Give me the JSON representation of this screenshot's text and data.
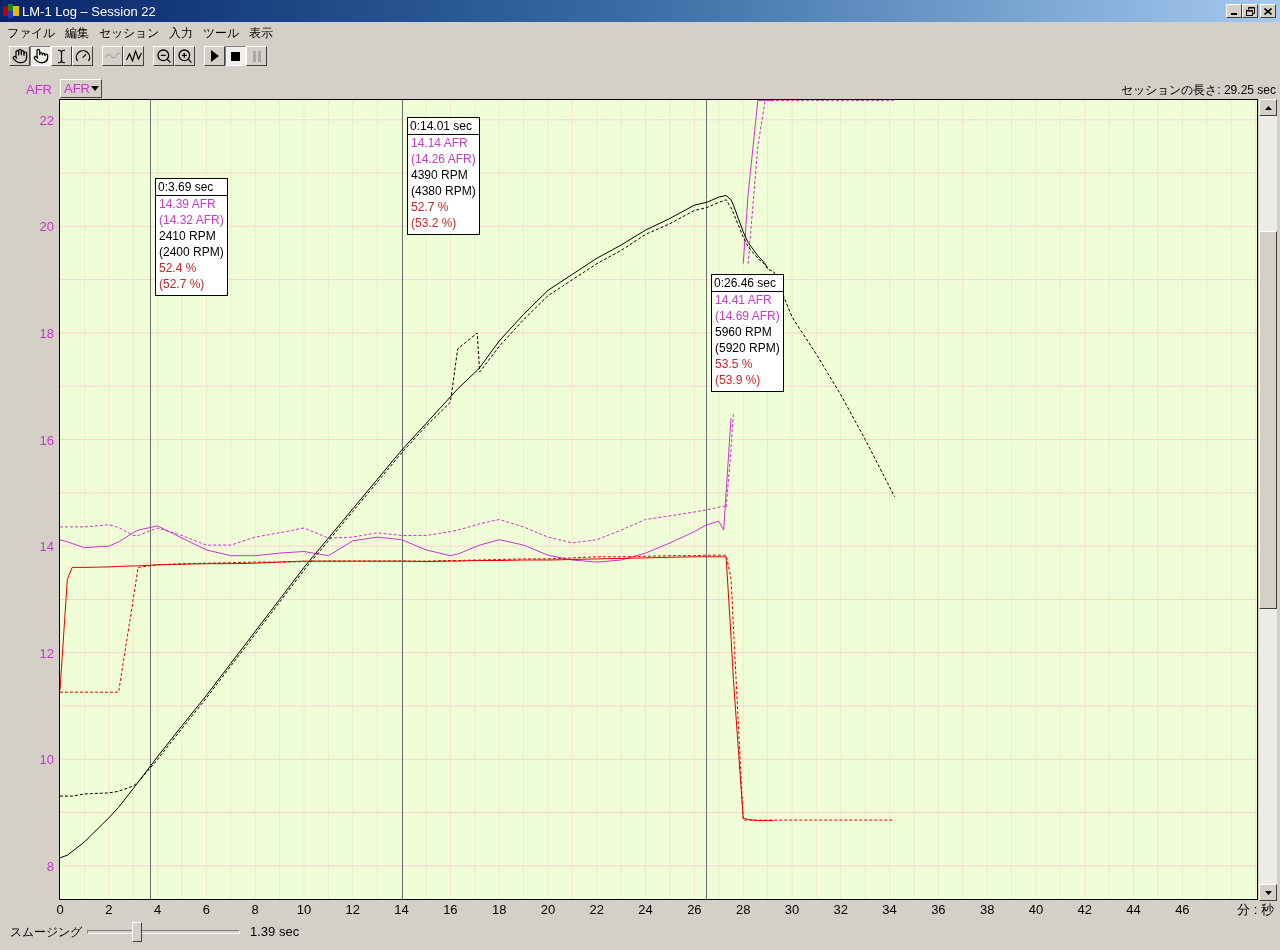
{
  "window": {
    "title": "LM-1 Log – Session 22"
  },
  "menu": [
    "ファイル",
    "編集",
    "セッション",
    "入力",
    "ツール",
    "表示"
  ],
  "toolbar": [
    {
      "buttons": [
        {
          "kind": "hand",
          "selected": false,
          "disabled": false
        },
        {
          "kind": "pointer",
          "selected": true,
          "disabled": false
        },
        {
          "kind": "cursor",
          "selected": false,
          "disabled": false
        },
        {
          "kind": "gauge",
          "selected": false,
          "disabled": false
        }
      ]
    },
    {
      "buttons": [
        {
          "kind": "smooth",
          "selected": false,
          "disabled": true
        },
        {
          "kind": "raw",
          "selected": false,
          "disabled": false
        }
      ]
    },
    {
      "buttons": [
        {
          "kind": "zoom_out",
          "selected": false,
          "disabled": false
        },
        {
          "kind": "zoom_in",
          "selected": false,
          "disabled": false
        }
      ]
    },
    {
      "buttons": [
        {
          "kind": "play",
          "selected": false,
          "disabled": false
        },
        {
          "kind": "stop",
          "selected": true,
          "disabled": false
        },
        {
          "kind": "pause",
          "selected": false,
          "disabled": true
        }
      ]
    }
  ],
  "chart": {
    "axis_selector": {
      "value": "AFR"
    },
    "session_length": "セッションの長さ: 29.25 sec",
    "chart_data": {
      "type": "line",
      "xlabel": "分 : 秒",
      "ylabel": "AFR",
      "grid": true,
      "xlim": [
        0,
        49.1
      ],
      "ylim": [
        7.36,
        22.39
      ],
      "xticks": [
        0,
        2,
        4,
        6,
        8,
        10,
        12,
        14,
        16,
        18,
        20,
        22,
        24,
        26,
        28,
        30,
        32,
        34,
        36,
        38,
        40,
        42,
        44,
        46
      ],
      "yticks": [
        8,
        10,
        12,
        14,
        16,
        18,
        20,
        22
      ],
      "x": [
        0,
        0.3,
        0.5,
        1,
        2,
        2.4,
        3,
        3.2,
        4,
        5,
        6,
        7,
        8,
        9,
        10,
        11,
        12,
        13,
        14,
        15,
        16,
        16.3,
        17.1,
        17.2,
        18,
        19,
        20,
        21,
        22,
        23,
        24,
        25,
        26,
        26.5,
        27,
        27.2,
        27.3,
        27.5,
        27.6,
        28,
        28.2,
        28.6,
        28.9,
        29,
        29.25,
        30,
        31,
        32,
        33,
        34.2
      ],
      "series": [
        {
          "color": "#cc33cc",
          "line_style": "solid",
          "values": [
            14.12,
            14.08,
            14.05,
            13.97,
            14.0,
            14.08,
            14.25,
            14.3,
            14.38,
            14.15,
            13.93,
            13.82,
            13.82,
            13.87,
            13.9,
            13.82,
            14.1,
            14.17,
            14.12,
            13.93,
            13.82,
            13.85,
            14.0,
            14.02,
            14.12,
            14.02,
            13.83,
            13.74,
            13.7,
            13.74,
            13.87,
            14.06,
            14.27,
            14.4,
            14.47,
            14.3,
            15.0,
            16.4,
            null,
            19.3,
            20.6,
            22.36,
            22.36,
            22.36,
            22.36,
            null,
            null,
            null,
            null,
            null
          ]
        },
        {
          "color": "#cc33cc",
          "line_style": "dashed",
          "values": [
            14.36,
            14.36,
            14.36,
            14.36,
            14.4,
            14.35,
            14.2,
            14.2,
            14.34,
            14.2,
            14.02,
            14.02,
            14.17,
            14.25,
            14.34,
            14.15,
            14.17,
            14.25,
            14.2,
            14.2,
            14.27,
            14.3,
            14.4,
            14.42,
            14.5,
            14.36,
            14.17,
            14.06,
            14.12,
            14.3,
            14.5,
            14.57,
            14.64,
            14.68,
            14.73,
            14.75,
            14.72,
            15.8,
            16.5,
            null,
            19.3,
            21.5,
            22.36,
            22.36,
            22.36,
            22.36,
            22.36,
            22.36,
            22.36,
            22.36
          ]
        },
        {
          "color": "#000000",
          "line_style": "solid",
          "values": [
            8.15,
            8.2,
            8.27,
            8.45,
            8.9,
            9.1,
            9.45,
            9.57,
            10.05,
            10.63,
            11.2,
            11.8,
            12.4,
            13.0,
            13.6,
            14.15,
            14.7,
            15.25,
            15.8,
            16.3,
            16.8,
            16.95,
            17.3,
            17.35,
            17.85,
            18.35,
            18.8,
            19.1,
            19.4,
            19.65,
            19.93,
            20.15,
            20.4,
            20.45,
            20.55,
            20.57,
            20.58,
            20.5,
            20.4,
            19.9,
            19.7,
            19.45,
            19.3,
            19.22,
            null,
            null,
            null,
            null,
            null,
            null
          ]
        },
        {
          "color": "#000000",
          "line_style": "dashed",
          "values": [
            9.31,
            9.31,
            9.31,
            9.35,
            9.37,
            9.4,
            9.5,
            9.57,
            10.0,
            10.58,
            11.15,
            11.75,
            12.35,
            12.95,
            13.55,
            14.1,
            14.65,
            15.2,
            15.75,
            16.25,
            16.7,
            17.7,
            18.0,
            17.27,
            17.75,
            18.25,
            18.7,
            19.0,
            19.3,
            19.55,
            19.85,
            20.05,
            20.3,
            20.35,
            20.45,
            20.48,
            20.5,
            20.35,
            20.25,
            19.8,
            19.62,
            19.4,
            19.28,
            19.2,
            19.15,
            18.3,
            17.6,
            16.84,
            16.0,
            14.93
          ]
        },
        {
          "color": "#e00000",
          "line_style": "solid",
          "values": [
            11.3,
            13.37,
            13.6,
            13.6,
            13.61,
            13.62,
            13.63,
            13.63,
            13.65,
            13.66,
            13.67,
            13.67,
            13.68,
            13.7,
            13.72,
            13.72,
            13.72,
            13.72,
            13.72,
            13.71,
            13.72,
            13.72,
            13.73,
            13.73,
            13.73,
            13.74,
            13.74,
            13.75,
            13.76,
            13.77,
            13.78,
            13.79,
            13.8,
            13.8,
            13.8,
            13.8,
            13.8,
            12.3,
            11.5,
            8.9,
            8.87,
            8.85,
            8.85,
            8.85,
            8.85,
            null,
            null,
            null,
            null,
            null
          ]
        },
        {
          "color": "#e00000",
          "line_style": "dashed",
          "values": [
            11.26,
            11.26,
            11.26,
            11.26,
            11.26,
            11.26,
            13.0,
            13.6,
            13.65,
            13.67,
            13.68,
            13.69,
            13.7,
            13.7,
            13.71,
            13.72,
            13.72,
            13.72,
            13.72,
            13.72,
            13.73,
            13.73,
            13.74,
            13.74,
            13.75,
            13.76,
            13.76,
            13.78,
            13.8,
            13.8,
            13.81,
            13.82,
            13.82,
            13.83,
            13.83,
            13.83,
            13.83,
            13.4,
            12.5,
            8.86,
            8.86,
            8.86,
            8.86,
            8.86,
            8.86,
            8.86,
            8.86,
            8.86,
            8.86,
            8.86
          ]
        }
      ],
      "ref_lines": [
        {
          "axis": "x",
          "value": 3.69
        },
        {
          "axis": "x",
          "value": 14.01
        },
        {
          "axis": "x",
          "value": 26.46
        }
      ],
      "annotations": [
        "0:3.69 sec",
        "0:14.01 sec",
        "0:26.46 sec"
      ]
    },
    "readouts": [
      {
        "lines": [
          {
            "text": "14.39 AFR",
            "color": "#c040c0"
          },
          {
            "text": "(14.32 AFR)",
            "color": "#c040c0"
          },
          {
            "text": "2410 RPM",
            "color": "#000000"
          },
          {
            "text": "(2400 RPM)",
            "color": "#000000"
          },
          {
            "text": "52.4 %",
            "color": "#c82828"
          },
          {
            "text": "(52.7 %)",
            "color": "#c82828"
          }
        ]
      },
      {
        "lines": [
          {
            "text": "14.14 AFR",
            "color": "#c040c0"
          },
          {
            "text": "(14.26 AFR)",
            "color": "#c040c0"
          },
          {
            "text": "4390 RPM",
            "color": "#000000"
          },
          {
            "text": "(4380 RPM)",
            "color": "#000000"
          },
          {
            "text": "52.7 %",
            "color": "#c82828"
          },
          {
            "text": "(53.2 %)",
            "color": "#c82828"
          }
        ]
      },
      {
        "lines": [
          {
            "text": "14.41 AFR",
            "color": "#c040c0"
          },
          {
            "text": "(14.69 AFR)",
            "color": "#c040c0"
          },
          {
            "text": "5960 RPM",
            "color": "#000000"
          },
          {
            "text": "(5920 RPM)",
            "color": "#000000"
          },
          {
            "text": "53.5 %",
            "color": "#c82828"
          },
          {
            "text": "(53.9 %)",
            "color": "#c82828"
          }
        ]
      }
    ]
  },
  "smoothing": {
    "label": "スムージング",
    "level": 0.31,
    "reading": "1.39 sec"
  }
}
